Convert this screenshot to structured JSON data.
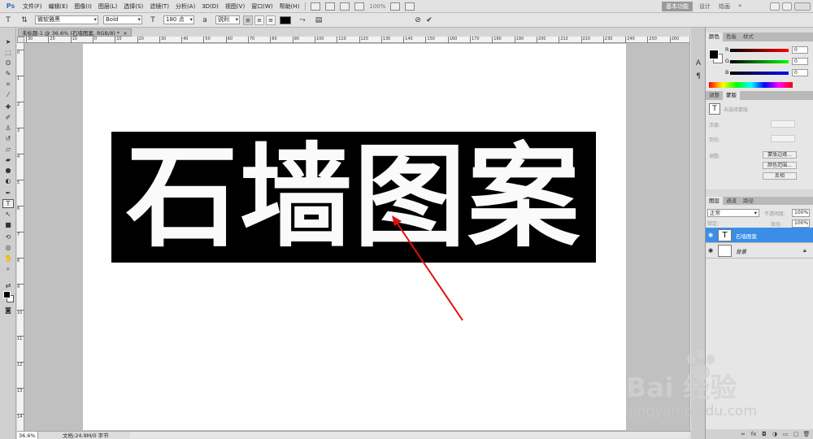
{
  "app": {
    "logo": "Ps"
  },
  "menu": [
    "文件(F)",
    "编辑(E)",
    "图像(I)",
    "图层(L)",
    "选择(S)",
    "滤镜(T)",
    "分析(A)",
    "3D(D)",
    "视图(V)",
    "窗口(W)",
    "帮助(H)"
  ],
  "menubar_right": {
    "zoom": "100%",
    "workspace_active": "基本功能",
    "workspace_2": "设计",
    "workspace_3": "绘画"
  },
  "options": {
    "font_family": "微软雅黑",
    "font_style": "Bold",
    "font_size": "180 点",
    "antialias": "锐利",
    "text_color": "#000000"
  },
  "document": {
    "tab_title": "未标题-1 @ 36.6% (石墙图案, RGB/8) *",
    "text": "石墙图案"
  },
  "rulers": {
    "h": [
      "30",
      "20",
      "10",
      "0",
      "10",
      "20",
      "30",
      "40",
      "50",
      "60",
      "70",
      "80",
      "90",
      "100",
      "110",
      "120",
      "130",
      "140",
      "150",
      "160",
      "170",
      "180",
      "190",
      "200",
      "210",
      "220",
      "230",
      "240",
      "250",
      "260"
    ],
    "v": [
      "0",
      "1",
      "2",
      "3",
      "4",
      "5",
      "6",
      "7",
      "8",
      "9",
      "10",
      "11",
      "12",
      "13",
      "14"
    ]
  },
  "status": {
    "zoom": "36.6%",
    "doc": "文档:24.9M/0 字节"
  },
  "color_panel": {
    "tabs": [
      "颜色",
      "色板",
      "样式"
    ],
    "r_label": "R",
    "g_label": "G",
    "b_label": "B",
    "r": "0",
    "g": "0",
    "b": "0"
  },
  "para_panel": {
    "tabs": [
      "调整",
      "蒙版"
    ],
    "placeholder": "未选择蒙版",
    "label_1": "浓度:",
    "label_2": "羽化:",
    "label_3": "调整:",
    "btn_1": "蒙版边缘...",
    "btn_2": "颜色范围...",
    "btn_3": "反相"
  },
  "layers_panel": {
    "tabs": [
      "图层",
      "通道",
      "路径"
    ],
    "blend_mode": "正常",
    "opacity_label": "不透明度:",
    "opacity": "100%",
    "lock_label": "锁定:",
    "fill_label": "填充:",
    "fill": "100%",
    "layers": [
      {
        "name": "石墙图案",
        "thumb": "T"
      },
      {
        "name": "背景",
        "thumb": ""
      }
    ]
  },
  "watermark": {
    "brand": "Bai 经验",
    "url": "jingyan.baidu.com"
  }
}
